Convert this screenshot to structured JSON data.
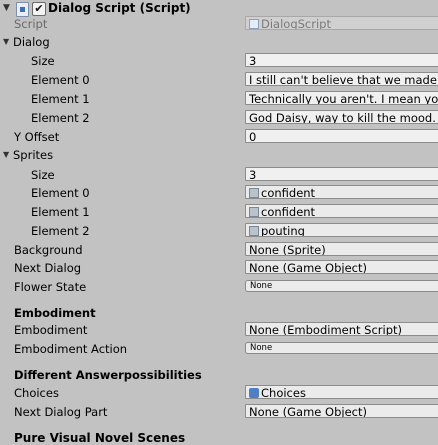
{
  "component": {
    "title": "Dialog Script (Script)",
    "enabled": "✔"
  },
  "script": {
    "label": "Script",
    "value": "DialogScript"
  },
  "dialog": {
    "label": "Dialog",
    "size_label": "Size",
    "size_value": "3",
    "elements": [
      {
        "label": "Element 0",
        "value": "I still can't believe that we made"
      },
      {
        "label": "Element 1",
        "value": "Technically you aren't. I mean yo"
      },
      {
        "label": "Element 2",
        "value": "God Daisy, way to kill the mood."
      }
    ]
  },
  "y_offset": {
    "label": "Y Offset",
    "value": "0"
  },
  "sprites": {
    "label": "Sprites",
    "size_label": "Size",
    "size_value": "3",
    "elements": [
      {
        "label": "Element 0",
        "value": "confident"
      },
      {
        "label": "Element 1",
        "value": "confident"
      },
      {
        "label": "Element 2",
        "value": "pouting"
      }
    ]
  },
  "background": {
    "label": "Background",
    "value": "None (Sprite)"
  },
  "next_dialog": {
    "label": "Next Dialog",
    "value": "None (Game Object)"
  },
  "flower_state": {
    "label": "Flower State",
    "value": "None"
  },
  "embodiment_section": {
    "header": "Embodiment"
  },
  "embodiment": {
    "label": "Embodiment",
    "value": "None (Embodiment Script)"
  },
  "embodiment_action": {
    "label": "Embodiment Action",
    "value": "None"
  },
  "answers_section": {
    "header": "Different Answerpossibilities"
  },
  "choices": {
    "label": "Choices",
    "value": "Choices"
  },
  "next_dialog_part": {
    "label": "Next Dialog Part",
    "value": "None (Game Object)"
  },
  "next_section": {
    "header": "Pure Visual Novel Scenes"
  }
}
